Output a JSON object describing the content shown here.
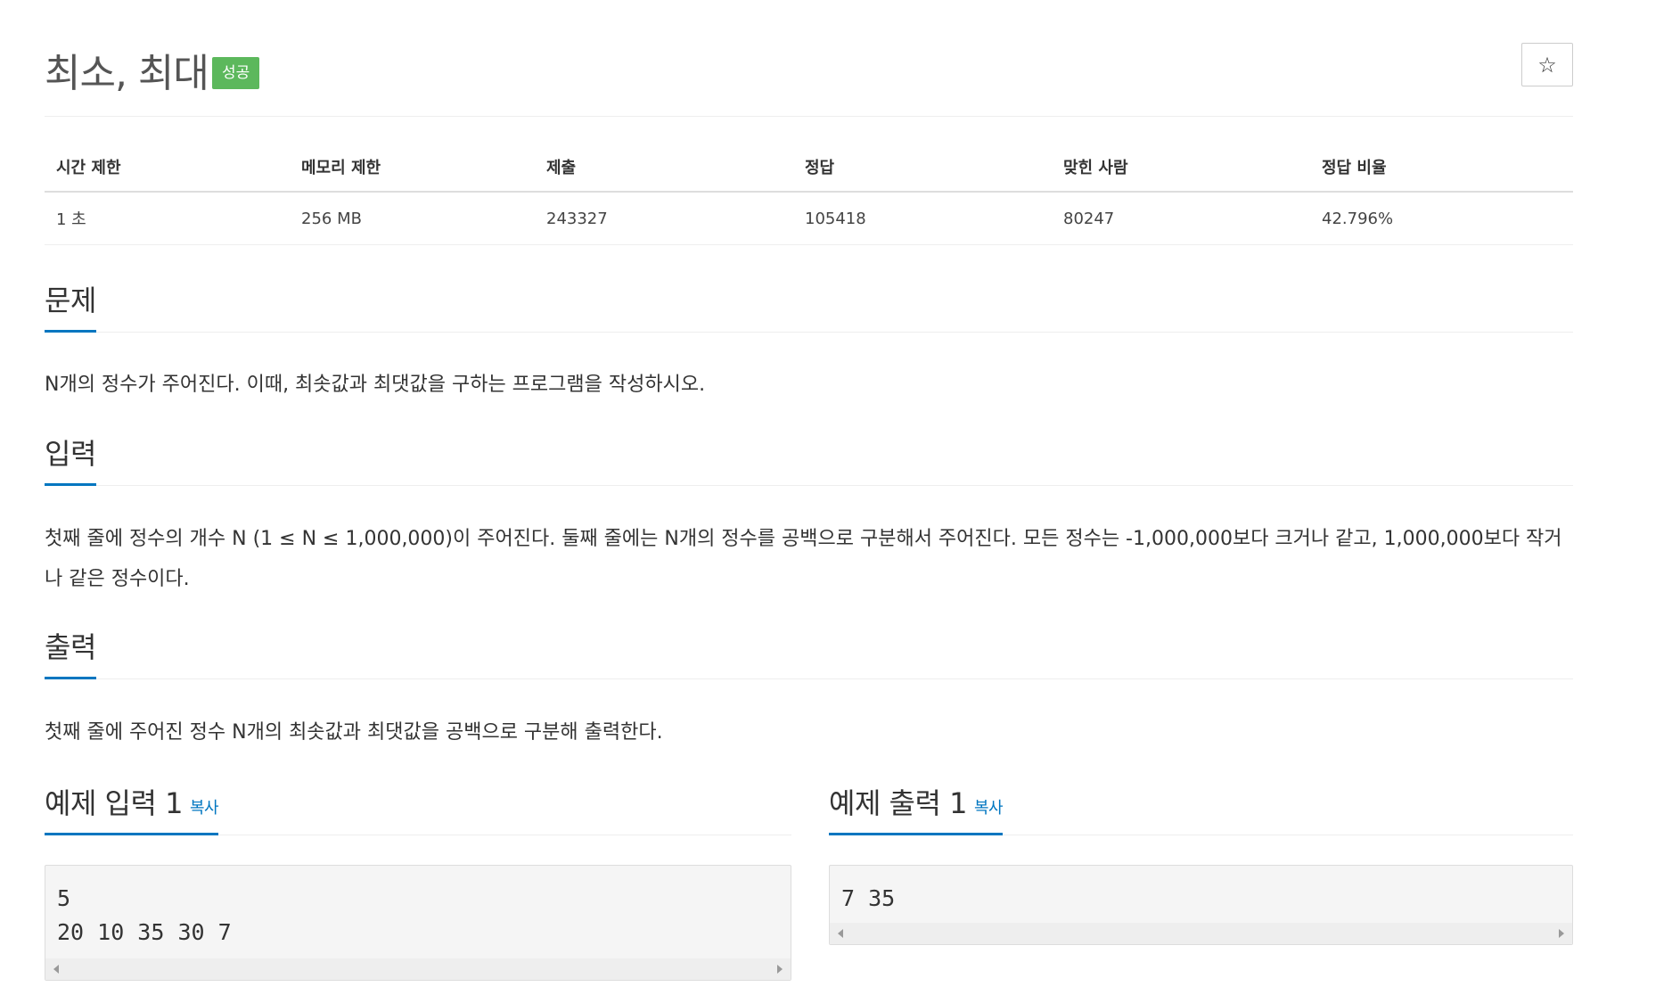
{
  "problem": {
    "title": "최소, 최대",
    "status_badge": "성공",
    "star_icon": "star-icon",
    "star_glyph": "☆"
  },
  "info_table": {
    "headers": [
      "시간 제한",
      "메모리 제한",
      "제출",
      "정답",
      "맞힌 사람",
      "정답 비율"
    ],
    "values": [
      "1 초",
      "256 MB",
      "243327",
      "105418",
      "80247",
      "42.796%"
    ]
  },
  "sections": {
    "description": {
      "heading": "문제",
      "text": "N개의 정수가 주어진다. 이때, 최솟값과 최댓값을 구하는 프로그램을 작성하시오."
    },
    "input": {
      "heading": "입력",
      "text": "첫째 줄에 정수의 개수 N (1 ≤ N ≤ 1,000,000)이 주어진다. 둘째 줄에는 N개의 정수를 공백으로 구분해서 주어진다. 모든 정수는 -1,000,000보다 크거나 같고, 1,000,000보다 작거나 같은 정수이다."
    },
    "output": {
      "heading": "출력",
      "text": "첫째 줄에 주어진 정수 N개의 최솟값과 최댓값을 공백으로 구분해 출력한다."
    }
  },
  "samples": {
    "input": {
      "heading": "예제 입력 1",
      "copy_label": "복사",
      "content": "5\n20 10 35 30 7"
    },
    "output": {
      "heading": "예제 출력 1",
      "copy_label": "복사",
      "content": "7 35"
    }
  },
  "colors": {
    "accent": "#0076c0",
    "success": "#5cb85c"
  }
}
